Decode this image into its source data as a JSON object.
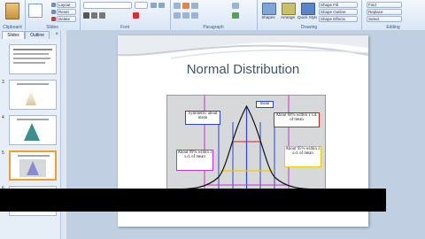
{
  "ribbon": {
    "clipboard_label": "Clipboard",
    "slides_label": "Slides",
    "font_label": "Font",
    "paragraph_label": "Paragraph",
    "drawing_label": "Drawing",
    "editing_label": "Editing",
    "paste_label": "Paste",
    "new_slide_label": "New Slide",
    "layout_label": "Layout",
    "reset_label": "Reset",
    "delete_label": "Delete",
    "shapes_label": "Shapes",
    "arrange_label": "Arrange",
    "quick_styles_label": "Quick Styles",
    "shape_fill_label": "Shape Fill",
    "shape_outline_label": "Shape Outline",
    "shape_effects_label": "Shape Effects",
    "find_label": "Find",
    "replace_label": "Replace",
    "select_label": "Select"
  },
  "panel": {
    "tab_slides": "Slides",
    "tab_outline": "Outline",
    "close": "×",
    "numbers": [
      "",
      "3",
      "4",
      "5",
      "6"
    ]
  },
  "slide": {
    "title": "Normal Distribution",
    "callouts": {
      "mean": "mean",
      "symmetric": "Symmetric about mean",
      "about68": "About 68% within 1 s.d. of mean",
      "about95": "About 95% within 2 s.d. of mean",
      "about99": "About 99% within 3 s.d. of mean"
    }
  },
  "colors": {
    "accent_orange": "#f0a030",
    "callout_red": "#cc2222",
    "callout_blue": "#3344cc",
    "callout_yellow": "#e8d000",
    "callout_magenta": "#cc33cc"
  }
}
